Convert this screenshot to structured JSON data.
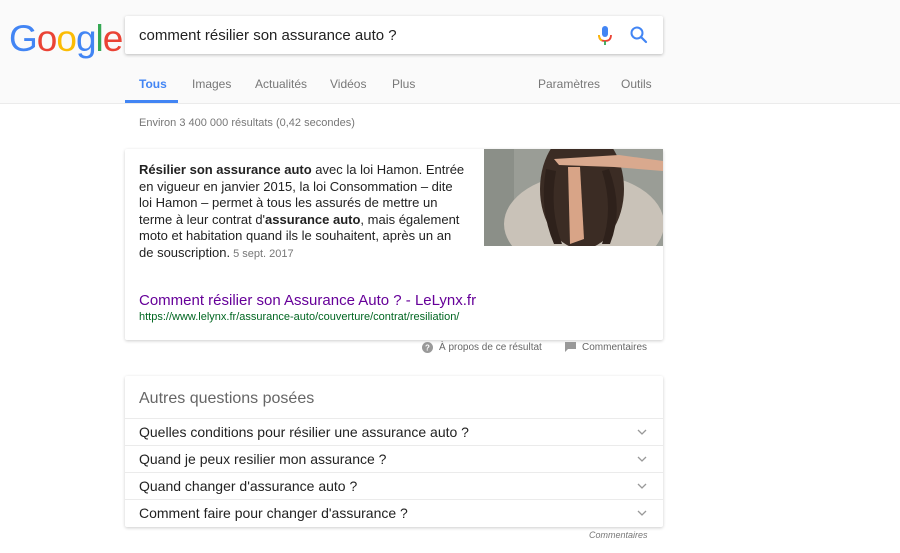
{
  "logo": {
    "letters": [
      "G",
      "o",
      "o",
      "g",
      "l",
      "e"
    ],
    "colors": [
      "#4285f4",
      "#ea4335",
      "#fbbc05",
      "#4285f4",
      "#34a853",
      "#ea4335"
    ]
  },
  "search": {
    "query": "comment résilier son assurance auto ?",
    "mic_icon": "microphone-icon",
    "search_icon": "magnifier-icon",
    "accent": "#4285f4"
  },
  "tabs": [
    {
      "label": "Tous",
      "active": true
    },
    {
      "label": "Images",
      "active": false
    },
    {
      "label": "Actualités",
      "active": false
    },
    {
      "label": "Vidéos",
      "active": false
    },
    {
      "label": "Plus",
      "active": false
    }
  ],
  "tools": {
    "settings_label": "Paramètres",
    "tools_label": "Outils"
  },
  "stats": "Environ 3 400 000 résultats (0,42 secondes)",
  "featured_snippet": {
    "text_parts": [
      {
        "text": "Résilier son assurance auto",
        "bold": true
      },
      {
        "text": " avec la loi Hamon. Entrée en vigueur en janvier 2015, la loi Consommation – dite loi Hamon – permet à tous les assurés de mettre un terme à leur contrat d'",
        "bold": false
      },
      {
        "text": "assurance auto",
        "bold": true
      },
      {
        "text": ", mais également moto et habitation quand ils le souhaitent, après un an de souscription.",
        "bold": false
      }
    ],
    "date": "5 sept. 2017",
    "image_alt": "woman making timeout hand gesture",
    "link_title": "Comment résilier son Assurance Auto ? - LeLynx.fr",
    "link_url": "https://www.lelynx.fr/assurance-auto/couverture/contrat/resiliation/"
  },
  "about": {
    "about_label": "À propos de ce résultat",
    "feedback_label": "Commentaires"
  },
  "people_also_ask": {
    "title": "Autres questions posées",
    "questions": [
      "Quelles conditions pour résilier une assurance auto ?",
      "Quand je peux resilier mon assurance ?",
      "Quand changer d'assurance auto ?",
      "Comment faire pour changer d'assurance ?"
    ],
    "feedback_label": "Commentaires"
  }
}
